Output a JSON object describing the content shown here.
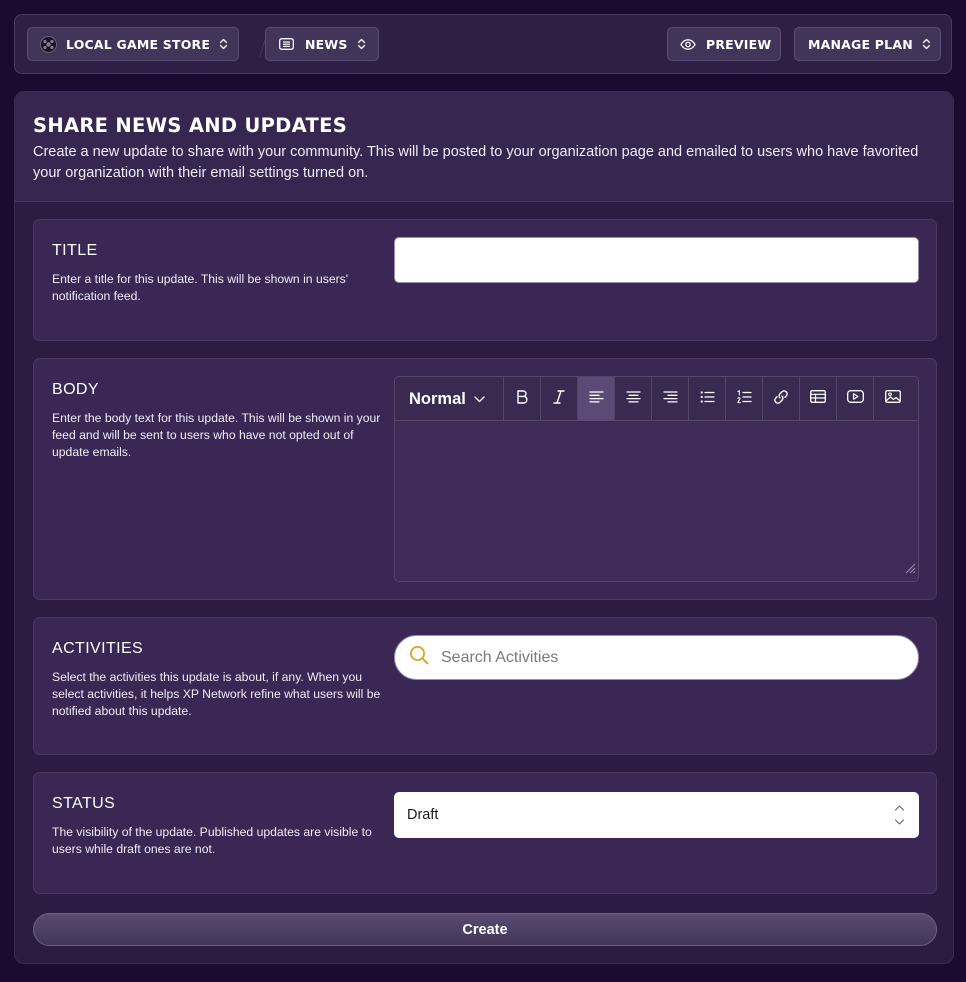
{
  "topbar": {
    "org_label": "LOCAL GAME STORE",
    "section_label": "NEWS",
    "preview_label": "PREVIEW",
    "manage_plan_label": "MANAGE PLAN"
  },
  "header": {
    "title": "SHARE NEWS AND UPDATES",
    "description": "Create a new update to share with your community. This will be posted to your organization page and emailed to users who have favorited your organization with their email settings turned on."
  },
  "form": {
    "title_section": {
      "label": "TITLE",
      "description": "Enter a title for this update. This will be shown in users' notification feed.",
      "value": ""
    },
    "body_section": {
      "label": "BODY",
      "description": "Enter the body text for this update. This will be shown in your feed and will be sent to users who have not opted out of update emails.",
      "format_value": "Normal",
      "toolbar_icons": [
        "bold-icon",
        "italic-icon",
        "align-left-icon",
        "align-center-icon",
        "align-right-icon",
        "bullet-list-icon",
        "numbered-list-icon",
        "link-icon",
        "table-icon",
        "video-icon",
        "image-icon"
      ],
      "active_tool": "align-left-icon"
    },
    "activities_section": {
      "label": "ACTIVITIES",
      "description": "Select the activities this update is about, if any. When you select activities, it helps XP Network refine what users will be notified about this update.",
      "search_placeholder": "Search Activities"
    },
    "status_section": {
      "label": "STATUS",
      "description": "The visibility of the update. Published updates are visible to users while draft ones are not.",
      "selected": "Draft"
    },
    "create_label": "Create"
  },
  "colors": {
    "background": "#1c0b30",
    "panel": "#2c1b42",
    "section": "#3a2753",
    "search_icon": "#d9a520"
  }
}
